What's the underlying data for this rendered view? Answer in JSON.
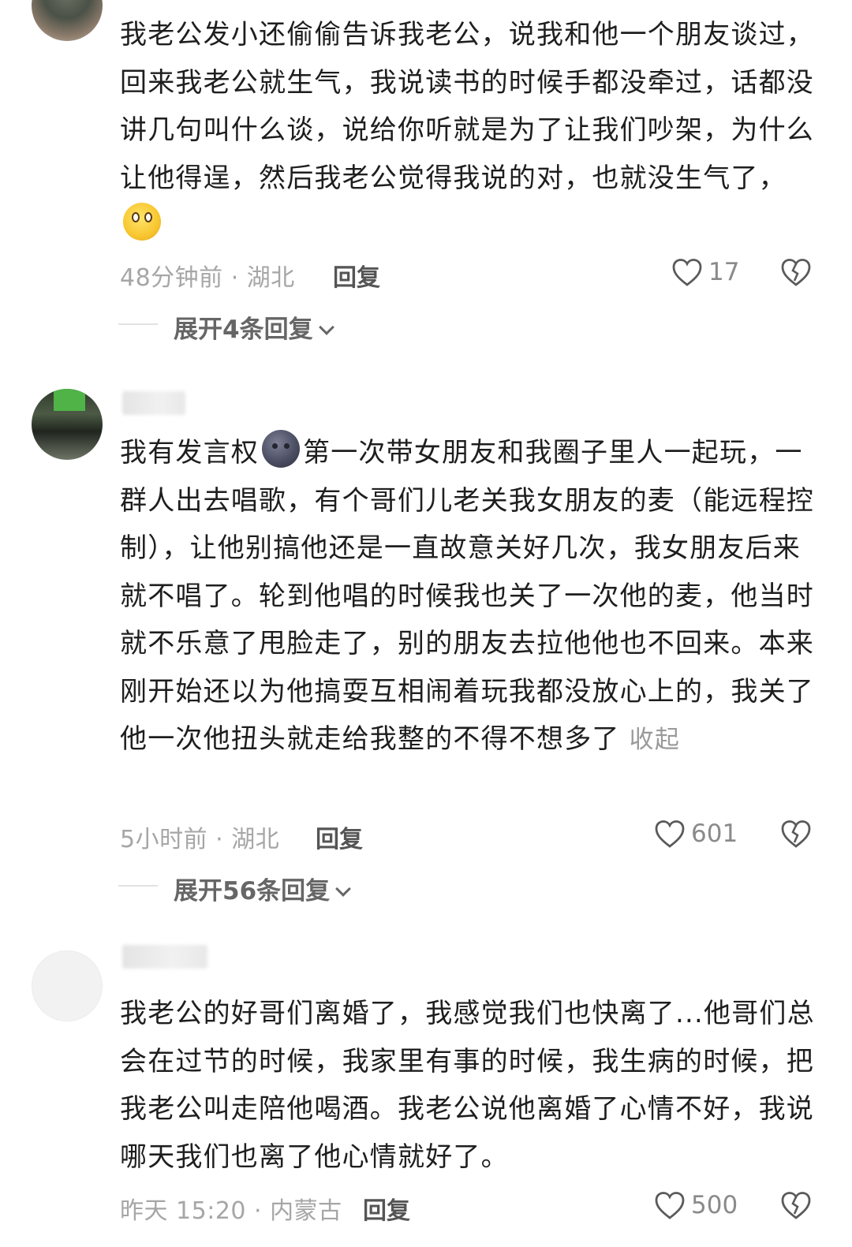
{
  "comments": [
    {
      "text_parts": [
        "我老公发小还偷偷告诉我老公，说我和他一个朋友谈过，回来我老公就生气，我说读书的时候手都没牵过，话都没讲几句叫什么谈，说给你听就是为了让我们吵架，为什么让他得逞，然后我老公觉得我说的对，也就没生气了，"
      ],
      "emoji": "smiling-face",
      "time_location": "48分钟前 · 湖北",
      "reply_label": "回复",
      "likes": "17",
      "expand_label": "展开4条回复"
    },
    {
      "text_before_emoji": "我有发言权",
      "emoji": "new-moon-face",
      "text_after_emoji": "第一次带女朋友和我圈子里人一起玩，一群人出去唱歌，有个哥们儿老关我女朋友的麦（能远程控制），让他别搞他还是一直故意关好几次，我女朋友后来就不唱了。轮到他唱的时候我也关了一次他的麦，他当时就不乐意了甩脸走了，别的朋友去拉他他也不回来。本来刚开始还以为他搞耍互相闹着玩我都没放心上的，我关了他一次他扭头就走给我整的不得不想多了",
      "collapse_label": "收起",
      "time_location": "5小时前 · 湖北",
      "reply_label": "回复",
      "likes": "601",
      "expand_label": "展开56条回复"
    },
    {
      "text": "我老公的好哥们离婚了，我感觉我们也快离了...他哥们总会在过节的时候，我家里有事的时候，我生病的时候，把我老公叫走陪他喝酒。我老公说他离婚了心情不好，我说哪天我们也离了他心情就好了。",
      "time_location": "昨天 15:20 · 内蒙古",
      "reply_label": "回复",
      "likes": "500"
    }
  ]
}
